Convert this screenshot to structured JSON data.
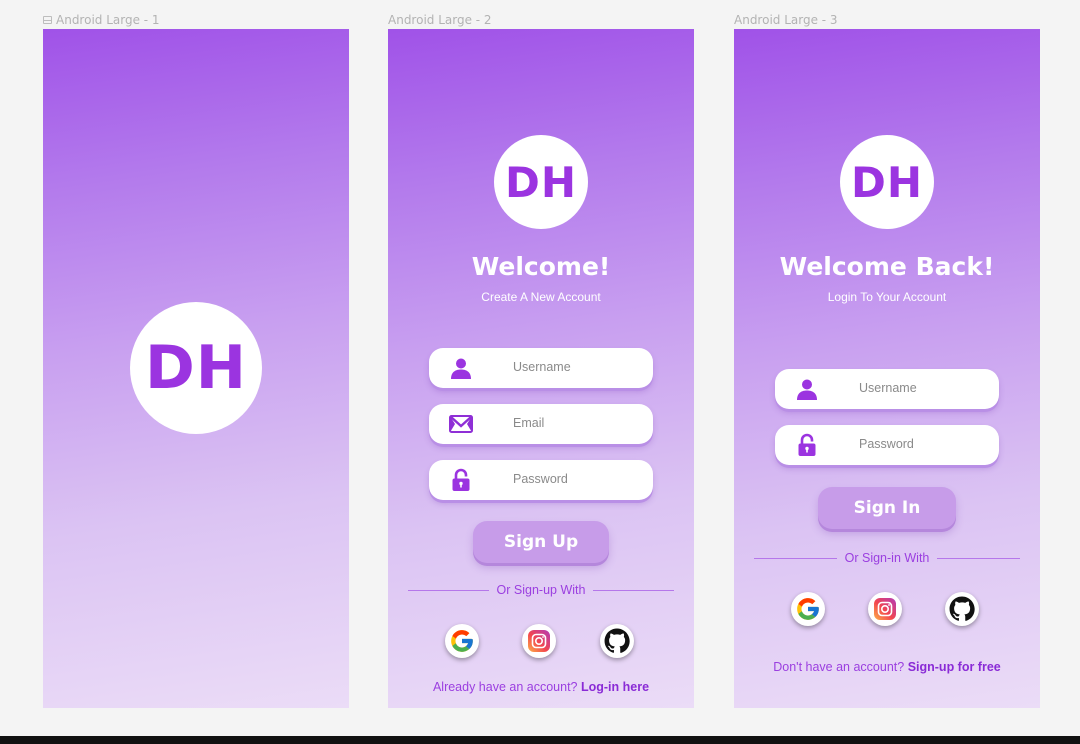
{
  "frames": [
    {
      "label": "Android Large - 1",
      "logo_text": "DH"
    },
    {
      "label": "Android Large - 2",
      "logo_text": "DH",
      "title": "Welcome!",
      "subtitle": "Create A New Account",
      "fields": [
        {
          "placeholder": "Username",
          "icon": "user-icon"
        },
        {
          "placeholder": "Email",
          "icon": "mail-icon"
        },
        {
          "placeholder": "Password",
          "icon": "lock-icon"
        }
      ],
      "button_label": "Sign Up",
      "divider_text": "Or Sign-up With",
      "socials": [
        "google-icon",
        "instagram-icon",
        "github-icon"
      ],
      "footer_text": "Already have an account?",
      "footer_link": "Log-in here"
    },
    {
      "label": "Android Large - 3",
      "logo_text": "DH",
      "title": "Welcome Back!",
      "subtitle": "Login To Your Account",
      "fields": [
        {
          "placeholder": "Username",
          "icon": "user-icon"
        },
        {
          "placeholder": "Password",
          "icon": "lock-icon"
        }
      ],
      "button_label": "Sign In",
      "divider_text": "Or Sign-in With",
      "socials": [
        "google-icon",
        "instagram-icon",
        "github-icon"
      ],
      "footer_text": "Don't have an account?",
      "footer_link": "Sign-up for free"
    }
  ],
  "colors": {
    "accent": "#9b34e0",
    "gradient_top": "#a052e8",
    "gradient_bottom": "#ebdcf7",
    "button": "#c79ce9"
  }
}
